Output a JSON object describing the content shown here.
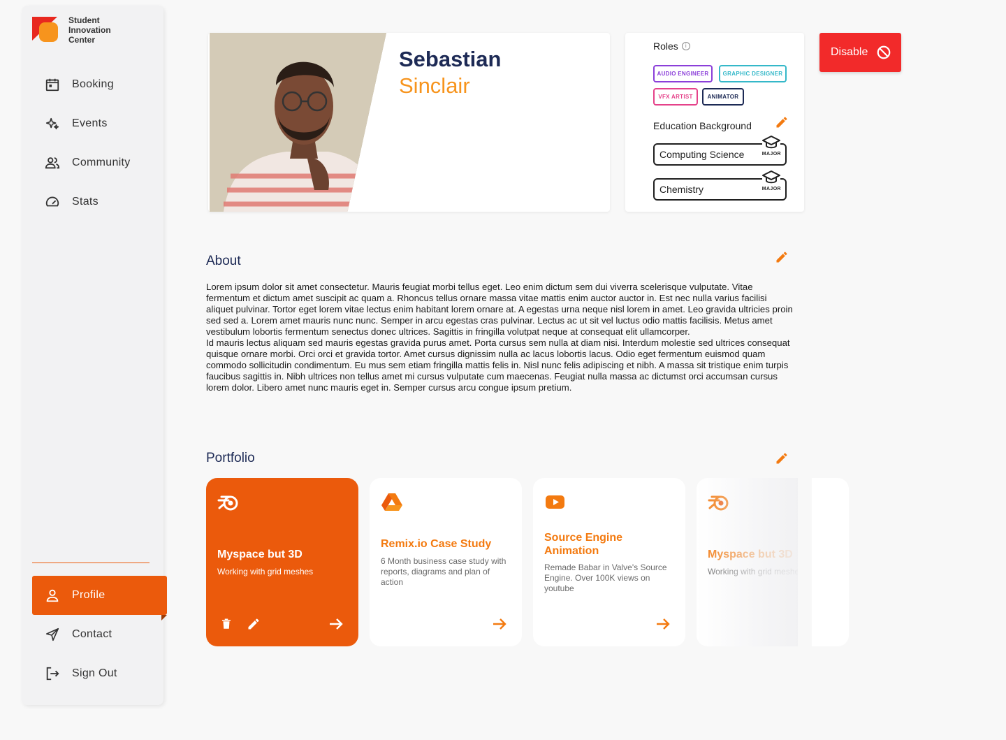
{
  "brand": {
    "name": "Student Innovation Center"
  },
  "sidebar": {
    "items": [
      {
        "label": "Booking",
        "icon": "calendar-icon"
      },
      {
        "label": "Events",
        "icon": "sparkle-icon"
      },
      {
        "label": "Community",
        "icon": "people-icon"
      },
      {
        "label": "Stats",
        "icon": "speedometer-icon"
      }
    ],
    "bottom_items": [
      {
        "label": "Profile",
        "icon": "person-icon",
        "active": true
      },
      {
        "label": "Contact",
        "icon": "send-icon"
      },
      {
        "label": "Sign Out",
        "icon": "logout-icon"
      }
    ]
  },
  "profile": {
    "first_name": "Sebastian",
    "last_name": "Sinclair"
  },
  "roles": {
    "title": "Roles",
    "tags": [
      {
        "label": "AUDIO ENGINEER",
        "color": "#8b3fd9"
      },
      {
        "label": "GRAPHIC DESIGNER",
        "color": "#35b8c9"
      },
      {
        "label": "VFX ARTIST",
        "color": "#e5428a"
      },
      {
        "label": "ANIMATOR",
        "color": "#1d2a55"
      }
    ]
  },
  "education": {
    "title": "Education Background",
    "items": [
      {
        "label": "Computing Science",
        "badge": "MAJOR"
      },
      {
        "label": "Chemistry",
        "badge": "MAJOR"
      }
    ]
  },
  "actions": {
    "disable_label": "Disable"
  },
  "about": {
    "title": "About",
    "paragraph1": "Lorem ipsum dolor sit amet consectetur. Mauris feugiat morbi tellus eget. Leo enim dictum sem dui viverra scelerisque vulputate. Vitae fermentum et dictum amet suscipit ac quam a. Rhoncus tellus ornare massa vitae mattis enim auctor auctor in. Est nec nulla varius facilisi aliquet pulvinar. Tortor eget lorem vitae lectus enim habitant lorem ornare at. A egestas urna neque nisl lorem in amet. Leo gravida ultricies proin sed sed a. Lorem amet mauris nunc nunc. Semper in arcu egestas cras pulvinar. Lectus ac ut sit vel luctus odio mattis facilisis. Metus amet vestibulum lobortis fermentum senectus donec ultrices. Sagittis in fringilla volutpat neque at consequat elit ullamcorper.",
    "paragraph2": "Id mauris lectus aliquam sed mauris egestas gravida purus amet. Porta cursus sem nulla at diam nisi. Interdum molestie sed ultrices consequat quisque ornare morbi. Orci orci et gravida tortor. Amet cursus dignissim nulla ac lacus lobortis lacus. Odio eget fermentum euismod quam commodo sollicitudin condimentum. Eu mus sem etiam fringilla mattis felis in. Nisl nunc felis adipiscing et nibh. A massa sit tristique enim turpis faucibus sagittis in. Nibh ultrices non tellus amet mi cursus vulputate cum maecenas. Feugiat nulla massa ac dictumst orci accumsan cursus lorem dolor. Libero amet nunc mauris eget in. Semper cursus arcu congue ipsum pretium."
  },
  "portfolio": {
    "title": "Portfolio",
    "cards": [
      {
        "title": "Myspace but 3D",
        "desc": "Working with grid meshes",
        "icon": "blender-icon"
      },
      {
        "title": "Remix.io Case Study",
        "desc": "6 Month business case study with reports, diagrams and plan of action",
        "icon": "google-drive-icon"
      },
      {
        "title": "Source Engine Animation",
        "desc": "Remade Babar in Valve's Source Engine. Over 100K views on youtube",
        "icon": "youtube-icon"
      },
      {
        "title": "Myspace but 3D",
        "desc": "Working with grid meshes",
        "icon": "blender-icon"
      }
    ]
  },
  "colors": {
    "accent": "#eb5a0c",
    "orange": "#f37a10",
    "navy": "#1d2a55",
    "danger": "#f22a2a"
  }
}
